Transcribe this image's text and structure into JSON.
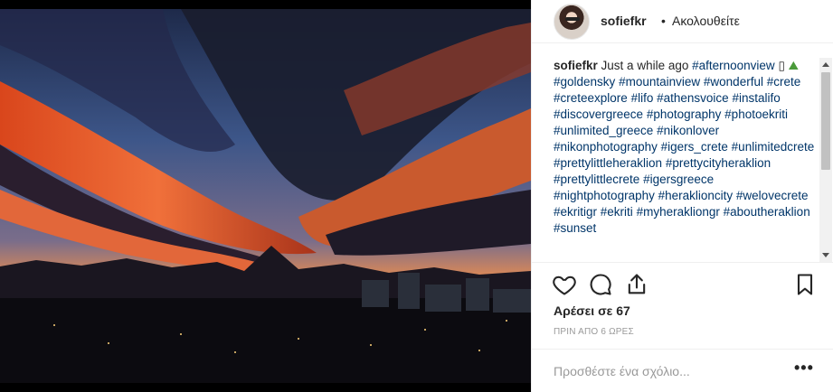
{
  "post": {
    "username": "sofiefkr",
    "follow_status": "Ακολουθείτε",
    "dot": "•"
  },
  "caption": {
    "user": "sofiefkr",
    "text": "Just a while ago",
    "box_glyph": "▯",
    "mountain_emoji": "⛰",
    "tags": [
      "#afternoonview",
      "#goldensky",
      "#mountainview",
      "#wonderful",
      "#crete",
      "#creteexplore",
      "#lifo",
      "#athensvoice",
      "#instalifo",
      "#discovergreece",
      "#photography",
      "#photoekriti",
      "#unlimited_greece",
      "#nikonlover",
      "#nikonphotography",
      "#igers_crete",
      "#unlimitedcrete",
      "#prettylittleheraklion",
      "#prettycityheraklion",
      "#prettylittlecrete",
      "#igersgreece",
      "#nightphotography",
      "#heraklioncity",
      "#welovecrete",
      "#ekritigr",
      "#ekriti",
      "#myherakliongr",
      "#aboutheraklion",
      "#sunset"
    ]
  },
  "actions": {
    "like_icon": "heart-outline",
    "comment_icon": "speech-bubble",
    "share_icon": "share-arrow",
    "save_icon": "bookmark"
  },
  "likes_text": "Αρέσει σε 67",
  "timestamp": "ΠΡΙΝ ΑΠΟ 6 ΩΡΕΣ",
  "comment": {
    "placeholder": "Προσθέστε ένα σχόλιο...",
    "more_label": "•••"
  },
  "colors": {
    "hashtag": "#003569",
    "text": "#262626",
    "muted": "#999999"
  }
}
